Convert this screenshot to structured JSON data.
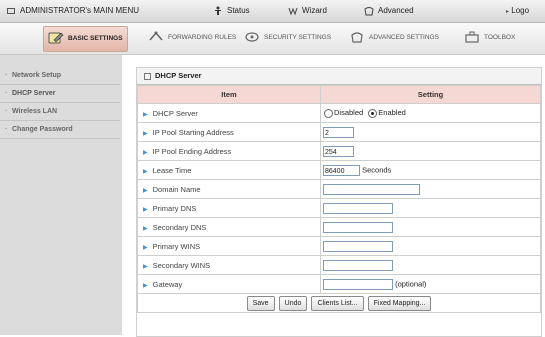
{
  "topbar": {
    "admin": "ADMINISTRATOR's MAIN MENU",
    "status": "Status",
    "wizard": "Wizard",
    "advanced": "Advanced",
    "logout": "Logo"
  },
  "tabs": {
    "basic": "BASIC SETTINGS",
    "forwarding": "FORWARDING RULES",
    "security": "SECURITY SETTINGS",
    "advanced": "ADVANCED SETTINGS",
    "toolbox": "TOOLBOX"
  },
  "sidebar": {
    "items": [
      {
        "label": "Network Setup"
      },
      {
        "label": "DHCP Server"
      },
      {
        "label": "Wireless LAN"
      },
      {
        "label": "Change Password"
      }
    ]
  },
  "panel": {
    "title": "DHCP Server",
    "col_item": "Item",
    "col_setting": "Setting",
    "rows": {
      "dhcp_server": "DHCP Server",
      "disabled": "Disabled",
      "enabled": "Enabled",
      "pool_start": "IP Pool Starting Address",
      "pool_start_value": "2",
      "pool_end": "IP Pool Ending Address",
      "pool_end_value": "254",
      "lease": "Lease Time",
      "lease_value": "86400",
      "lease_unit": "Seconds",
      "domain": "Domain Name",
      "pdns": "Primary DNS",
      "sdns": "Secondary DNS",
      "pwins": "Primary WINS",
      "swins": "Secondary WINS",
      "gateway": "Gateway",
      "optional": "(optional)"
    },
    "buttons": {
      "save": "Save",
      "undo": "Undo",
      "clients": "Clients List...",
      "fixed": "Fixed Mapping..."
    }
  }
}
